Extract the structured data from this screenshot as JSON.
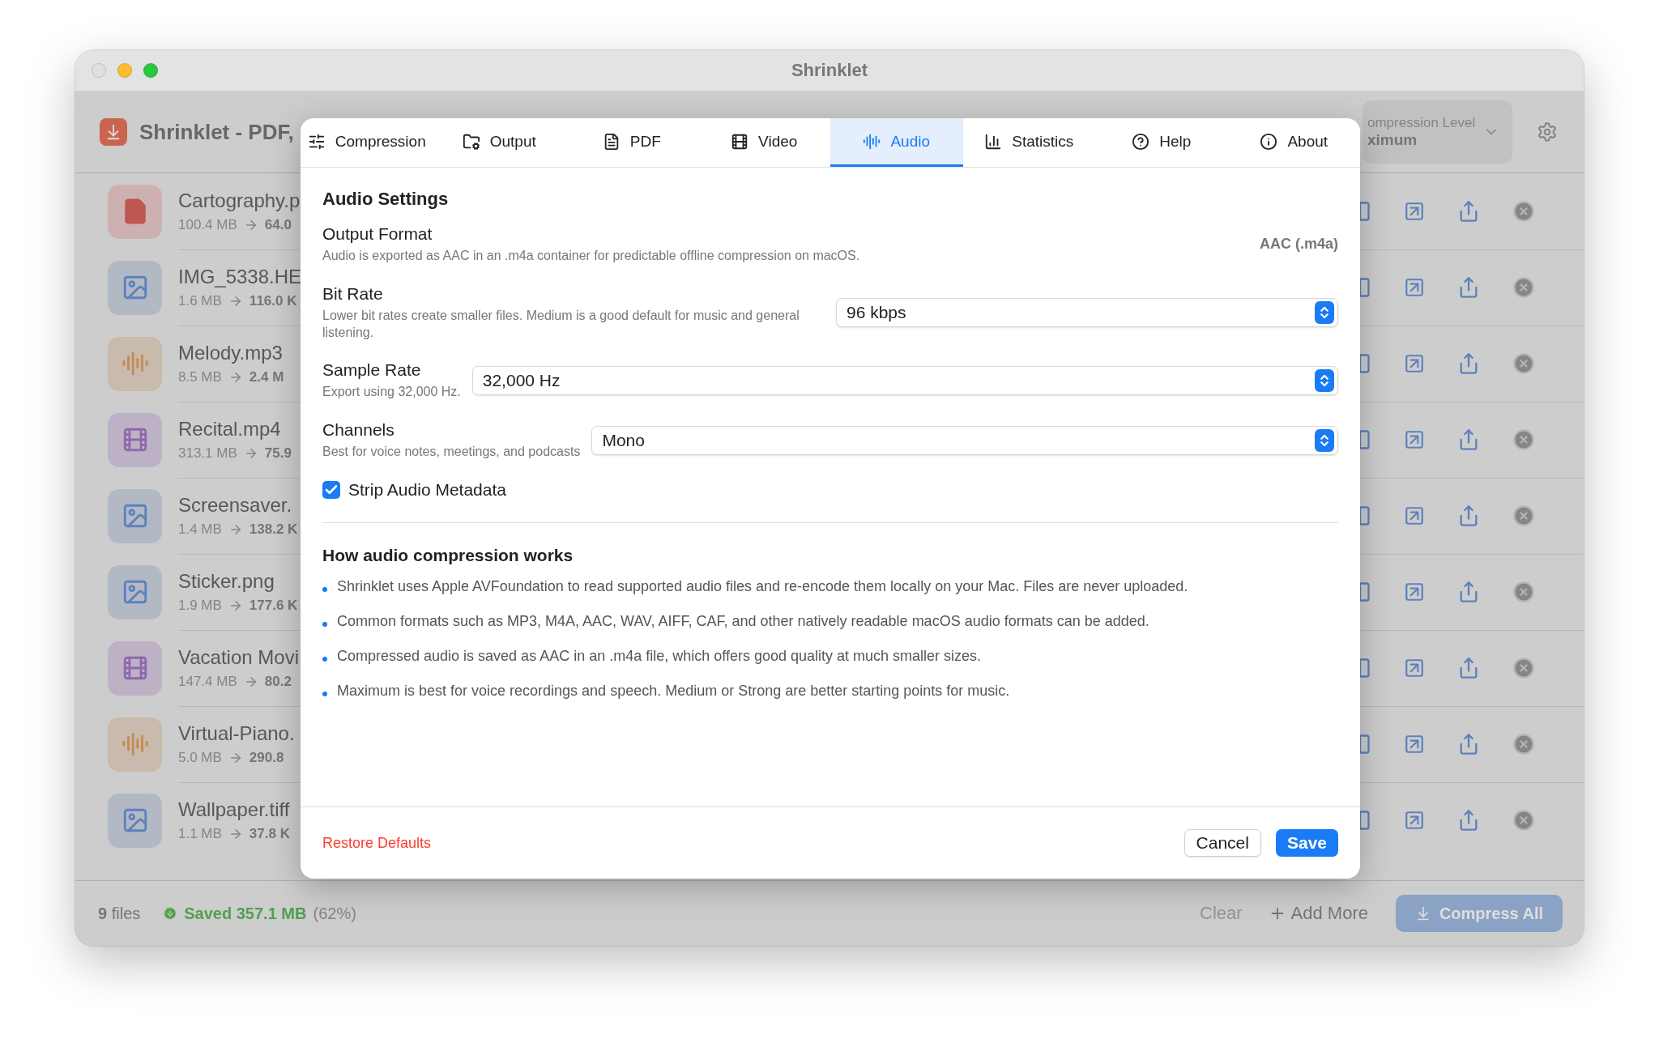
{
  "window": {
    "title": "Shrinklet"
  },
  "header": {
    "app_title": "Shrinklet - PDF,",
    "compression_level": {
      "label": "ompression Level",
      "value": "ximum"
    }
  },
  "files": [
    {
      "kind": "pdf",
      "name": "Cartography.p",
      "original": "100.4 MB",
      "compressed": "64.0"
    },
    {
      "kind": "image",
      "name": "IMG_5338.HE",
      "original": "1.6 MB",
      "compressed": "116.0 K"
    },
    {
      "kind": "audio",
      "name": "Melody.mp3",
      "original": "8.5 MB",
      "compressed": "2.4 M"
    },
    {
      "kind": "video",
      "name": "Recital.mp4",
      "original": "313.1 MB",
      "compressed": "75.9"
    },
    {
      "kind": "image",
      "name": "Screensaver.",
      "original": "1.4 MB",
      "compressed": "138.2 K"
    },
    {
      "kind": "image",
      "name": "Sticker.png",
      "original": "1.9 MB",
      "compressed": "177.6 K"
    },
    {
      "kind": "video",
      "name": "Vacation Movi",
      "original": "147.4 MB",
      "compressed": "80.2"
    },
    {
      "kind": "audio",
      "name": "Virtual-Piano.",
      "original": "5.0 MB",
      "compressed": "290.8"
    },
    {
      "kind": "image",
      "name": "Wallpaper.tiff",
      "original": "1.1 MB",
      "compressed": "37.8 K"
    }
  ],
  "status_bar": {
    "count": "9",
    "count_label": "files",
    "saved": "Saved 357.1 MB",
    "percent": "(62%)",
    "clear": "Clear",
    "add_more": "Add More",
    "compress_all": {
      "label": "Compress All",
      "disabled": true
    }
  },
  "dialog": {
    "tabs": [
      {
        "label": "Compression",
        "selected": false
      },
      {
        "label": "Output",
        "selected": false
      },
      {
        "label": "PDF",
        "selected": false
      },
      {
        "label": "Video",
        "selected": false
      },
      {
        "label": "Audio",
        "selected": true
      },
      {
        "label": "Statistics",
        "selected": false
      },
      {
        "label": "Help",
        "selected": false
      },
      {
        "label": "About",
        "selected": false
      }
    ],
    "title": "Audio Settings",
    "settings": [
      {
        "kind": "value",
        "label": "Output Format",
        "description": "Audio is exported as AAC in an .m4a container for predictable offline compression on macOS.",
        "value": "AAC (.m4a)"
      },
      {
        "kind": "select",
        "label": "Bit Rate",
        "description": "Lower bit rates create smaller files. Medium is a good default for music and general listening.",
        "value": "96 kbps"
      },
      {
        "kind": "select",
        "label": "Sample Rate",
        "description": "Export using 32,000 Hz.",
        "value": "32,000 Hz"
      },
      {
        "kind": "select",
        "label": "Channels",
        "description": "Best for voice notes, meetings, and podcasts",
        "value": "Mono"
      },
      {
        "kind": "checkbox",
        "label": "Strip Audio Metadata",
        "checked": true
      }
    ],
    "how_title": "How audio compression works",
    "bullets": [
      "Shrinklet uses Apple AVFoundation to read supported audio files and re-encode them locally on your Mac. Files are never uploaded.",
      "Common formats such as MP3, M4A, AAC, WAV, AIFF, CAF, and other natively readable macOS audio formats can be added.",
      "Compressed audio is saved as AAC in an .m4a file, which offers good quality at much smaller sizes.",
      "Maximum is best for voice recordings and speech. Medium or Strong are better starting points for music."
    ],
    "restore": "Restore Defaults",
    "cancel": "Cancel",
    "save": "Save"
  }
}
